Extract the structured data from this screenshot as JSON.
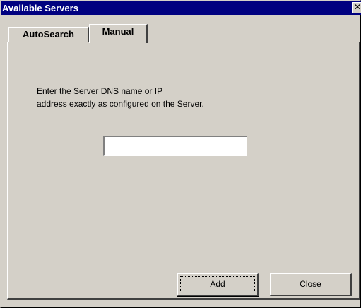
{
  "window": {
    "title": "Available Servers",
    "close_glyph": "✕"
  },
  "tabs": [
    {
      "label": "AutoSearch",
      "selected": false
    },
    {
      "label": "Manual",
      "selected": true
    }
  ],
  "manual": {
    "instruction_line1": "Enter the Server DNS name or IP",
    "instruction_line2": "address exactly as configured on the Server.",
    "server_input_value": ""
  },
  "buttons": {
    "add_label": "Add",
    "close_label": "Close"
  },
  "colors": {
    "titlebar": "#000080",
    "face": "#d4d0c8"
  }
}
